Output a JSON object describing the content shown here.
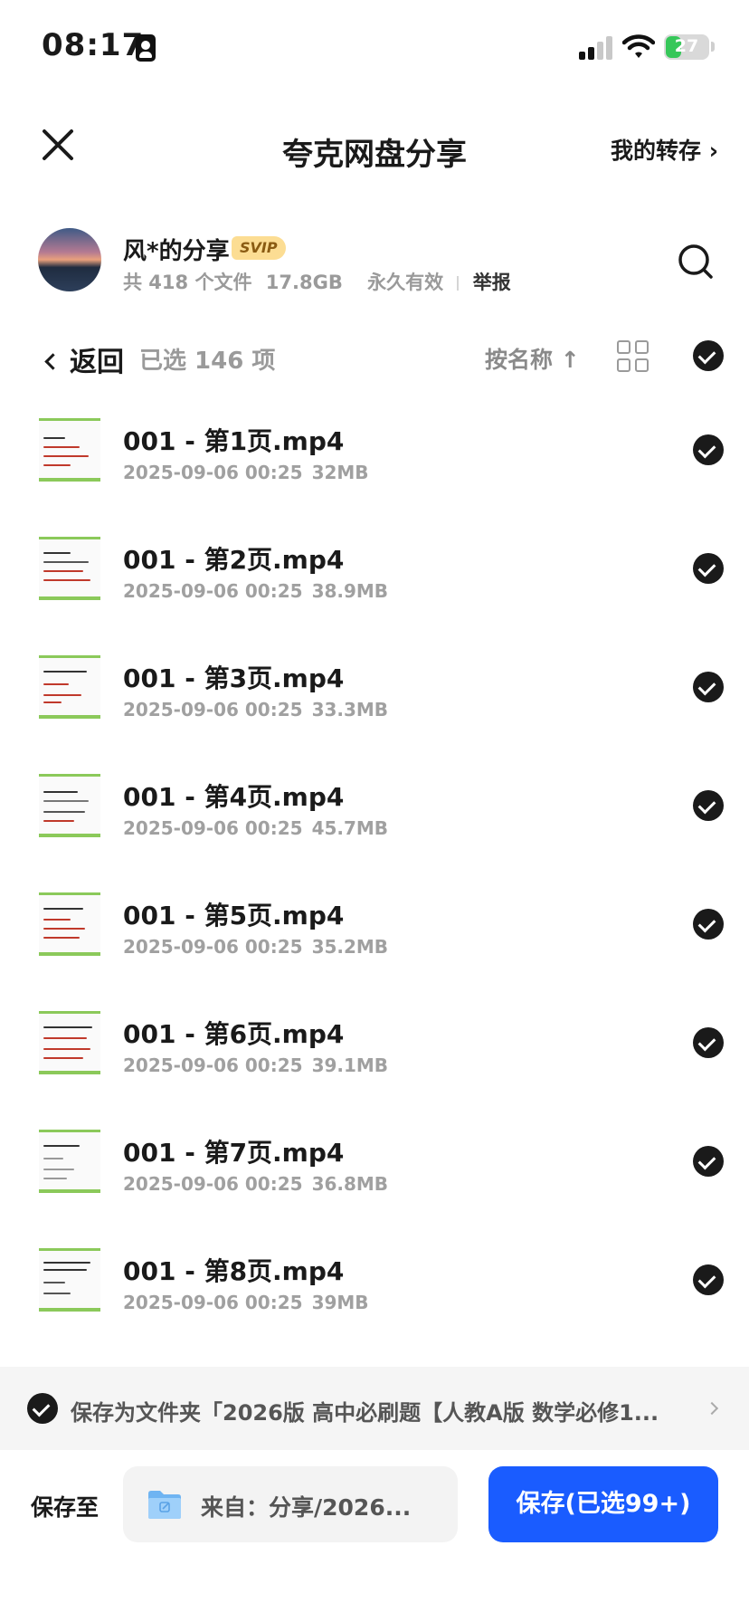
{
  "status_bar": {
    "time": "08:17",
    "battery": "27"
  },
  "nav": {
    "title": "夸克网盘分享",
    "my_transfer": "我的转存 ›"
  },
  "share": {
    "owner": "风*的分享",
    "badge": "SVIP",
    "file_count": "共 418 个文件",
    "size": "17.8GB",
    "validity": "永久有效",
    "report": "举报"
  },
  "toolbar": {
    "back": "返回",
    "selected": "已选 146 项",
    "sort": "按名称 ↑"
  },
  "files": [
    {
      "name": "001 - 第1页.mp4",
      "date": "2025-09-06 00:25",
      "size": "32MB"
    },
    {
      "name": "001 - 第2页.mp4",
      "date": "2025-09-06 00:25",
      "size": "38.9MB"
    },
    {
      "name": "001 - 第3页.mp4",
      "date": "2025-09-06 00:25",
      "size": "33.3MB"
    },
    {
      "name": "001 - 第4页.mp4",
      "date": "2025-09-06 00:25",
      "size": "45.7MB"
    },
    {
      "name": "001 - 第5页.mp4",
      "date": "2025-09-06 00:25",
      "size": "35.2MB"
    },
    {
      "name": "001 - 第6页.mp4",
      "date": "2025-09-06 00:25",
      "size": "39.1MB"
    },
    {
      "name": "001 - 第7页.mp4",
      "date": "2025-09-06 00:25",
      "size": "36.8MB"
    },
    {
      "name": "001 - 第8页.mp4",
      "date": "2025-09-06 00:25",
      "size": "39MB"
    }
  ],
  "save_folder": {
    "text": "保存为文件夹「2026版 高中必刷题【人教A版 数学必修1..."
  },
  "footer": {
    "save_to_label": "保存至",
    "destination": "来自：分享/2026...",
    "save_button": "保存(已选99+)"
  },
  "colors": {
    "accent": "#1a5cff",
    "check": "#1a1a1a",
    "svip_bg": "#fcdd93",
    "battery_green": "#36c759",
    "thumb_green": "#8bc95a"
  }
}
